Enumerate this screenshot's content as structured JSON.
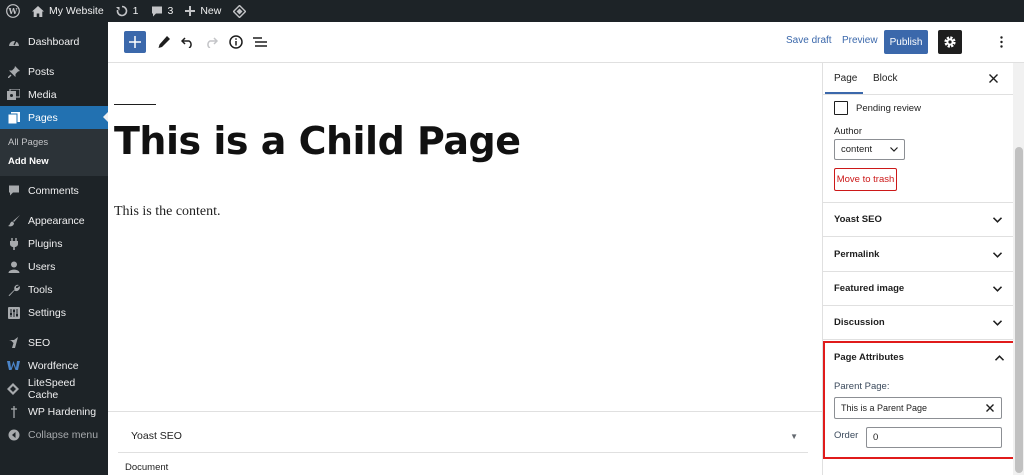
{
  "admin_bar": {
    "site_name": "My Website",
    "updates_count": "1",
    "comments_count": "3",
    "new_label": "New"
  },
  "admin_menu": {
    "items": [
      {
        "label": "Dashboard",
        "icon": "dashboard-icon"
      },
      {
        "label": "Posts",
        "icon": "pushpin-icon"
      },
      {
        "label": "Media",
        "icon": "media-icon"
      },
      {
        "label": "Pages",
        "icon": "pages-icon"
      },
      {
        "label": "Comments",
        "icon": "comment-icon"
      },
      {
        "label": "Appearance",
        "icon": "paintbrush-icon"
      },
      {
        "label": "Plugins",
        "icon": "plugin-icon"
      },
      {
        "label": "Users",
        "icon": "user-icon"
      },
      {
        "label": "Tools",
        "icon": "wrench-icon"
      },
      {
        "label": "Settings",
        "icon": "settings-sliders-icon"
      },
      {
        "label": "SEO",
        "icon": "yoast-icon"
      },
      {
        "label": "Wordfence",
        "icon": "wordfence-icon"
      },
      {
        "label": "LiteSpeed Cache",
        "icon": "litespeed-icon"
      },
      {
        "label": "WP Hardening",
        "icon": "hardening-icon"
      }
    ],
    "pages_submenu": [
      "All Pages",
      "Add New"
    ],
    "collapse_label": "Collapse menu"
  },
  "header": {
    "save_draft": "Save draft",
    "preview": "Preview",
    "publish": "Publish"
  },
  "editor": {
    "title": "This is a Child Page",
    "content": "This is the content."
  },
  "metabox": {
    "title": "Yoast SEO",
    "toggle": "▼"
  },
  "footer": {
    "breadcrumb": "Document"
  },
  "sidebar": {
    "tabs": [
      "Page",
      "Block"
    ],
    "pending_review": "Pending review",
    "author_label": "Author",
    "author_value": "content",
    "move_to_trash": "Move to trash",
    "panels": [
      "Yoast SEO",
      "Permalink",
      "Featured image",
      "Discussion"
    ],
    "page_attributes": {
      "title": "Page Attributes",
      "parent_label": "Parent Page:",
      "parent_value": "This is a Parent Page",
      "order_label": "Order",
      "order_value": "0"
    }
  },
  "colors": {
    "admin_dark": "#1d2327",
    "admin_accent": "#2271b1",
    "editor_blue": "#3b68ab",
    "highlight_red": "#e01b1b",
    "trash_red": "#cc1818"
  }
}
